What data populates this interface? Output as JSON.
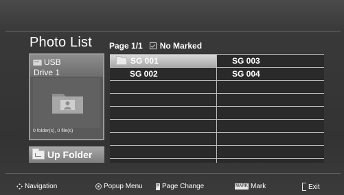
{
  "header": {
    "title": "Photo List",
    "page_label": "Page 1/1",
    "mark_status": "No Marked"
  },
  "device": {
    "name_line1": "USB",
    "name_line2": "Drive 1",
    "status": "0 folder(s), 0 file(s)"
  },
  "navigation": {
    "up_folder_label": "Up Folder"
  },
  "file_list": {
    "items": [
      {
        "name": "SG 001",
        "selected": true
      },
      {
        "name": "SG 003",
        "selected": false
      },
      {
        "name": "SG 002",
        "selected": false
      },
      {
        "name": "SG 004",
        "selected": false
      }
    ]
  },
  "help_bar": {
    "navigation": "Navigation",
    "popup_menu": "Popup Menu",
    "page_key": "P",
    "page_change": "Page Change",
    "mark_key": "MARK",
    "mark": "Mark",
    "exit": "Exit"
  },
  "icons": {
    "usb": "usb-drive-icon",
    "folder": "folder-icon",
    "photo_folder": "photo-folder-icon",
    "up_folder": "up-folder-icon",
    "checkbox": "checkbox-icon",
    "navigation": "navigation-arrows-icon",
    "popup": "radio-button-icon",
    "page": "page-key-icon",
    "mark": "mark-key-icon",
    "exit": "exit-icon"
  },
  "colors": {
    "background": "#3e3e3e",
    "selection": "#bcbcbc",
    "grid_lines": "#c0c0c0",
    "text": "#ffffff"
  }
}
